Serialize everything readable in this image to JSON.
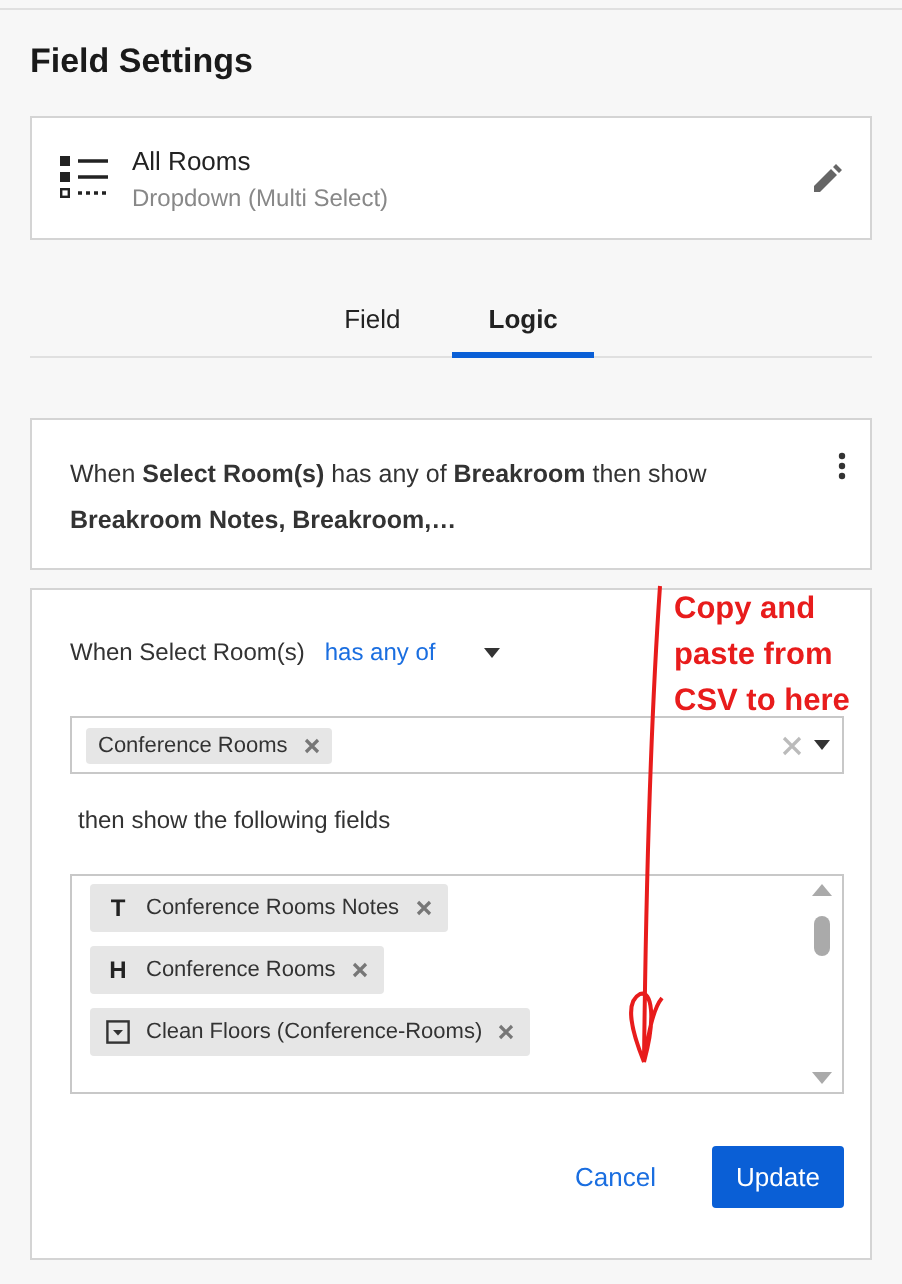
{
  "title": "Field Settings",
  "field": {
    "name": "All Rooms",
    "type": "Dropdown (Multi Select)"
  },
  "tabs": [
    {
      "label": "Field",
      "selected": false
    },
    {
      "label": "Logic",
      "selected": true
    }
  ],
  "rule_summary": "When **Select Room(s)** has any of **Breakroom** then show **Breakroom Notes, Breakroom,…**",
  "editor": {
    "condition_label": "When Select Room(s)",
    "operator": "has any of",
    "selected_values": [
      "Conference Rooms"
    ],
    "fields_label": "then show the following fields",
    "fields": [
      {
        "kind": "text",
        "glyph": "T",
        "label": "Conference Rooms Notes"
      },
      {
        "kind": "heading",
        "glyph": "H",
        "label": "Conference Rooms"
      },
      {
        "kind": "dropdown",
        "label": "Clean Floors (Conference-Rooms)"
      }
    ],
    "buttons": {
      "cancel": "Cancel",
      "update": "Update"
    }
  },
  "annotation": "Copy and paste from CSV to here"
}
